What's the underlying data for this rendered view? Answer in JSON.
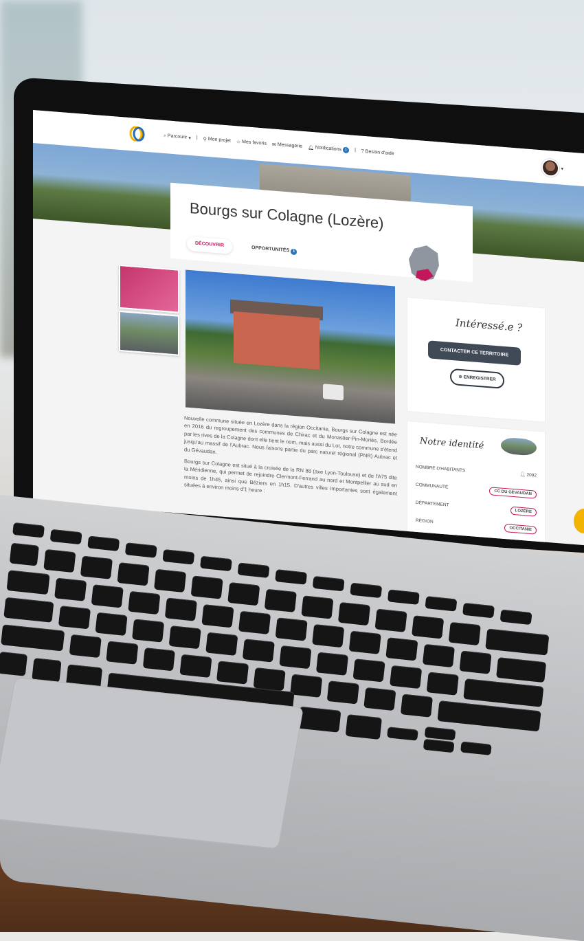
{
  "nav": {
    "items": [
      {
        "icon": "search-icon",
        "label": "Parcourir",
        "has_dropdown": true
      },
      {
        "icon": "pin-icon",
        "label": "Mon projet"
      },
      {
        "icon": "star-icon",
        "label": "Mes favoris"
      },
      {
        "icon": "mail-icon",
        "label": "Messagerie"
      },
      {
        "icon": "bell-icon",
        "label": "Notifications",
        "badge": "1"
      },
      {
        "icon": "help-icon",
        "label": "Besoin d'aide"
      }
    ]
  },
  "page": {
    "title": "Bourgs sur Colagne (Lozère)",
    "tabs": [
      {
        "label": "DÉCOUVRIR",
        "active": true
      },
      {
        "label": "OPPORTUNITÉS",
        "badge": "1",
        "active": false
      }
    ]
  },
  "description": {
    "paragraphs": [
      "Nouvelle commune située en Lozère dans la région Occitanie, Bourgs sur Colagne est née en 2016 du regroupement des communes de Chirac et du Monastier-Pin-Moriès. Bordée par les rives de la Colagne dont elle tient le nom, mais aussi du Lot, notre commune s'étend jusqu'au massif de l'Aubrac. Nous faisons partie du parc naturel régional (PNR) Aubrac et du Gévaudan.",
      "Bourgs sur Colagne est situé à la croisée de la RN 88 (axe Lyon-Toulouse) et de l'A75 dite la Méridienne, qui permet de rejoindre Clermont-Ferrand au nord et Montpellier au sud en moins de 1h45, ainsi que Béziers en 1h15. D'autres villes importantes sont également situées à environ moins d'1 heure :"
    ]
  },
  "interest_panel": {
    "heading": "Intéressé.e ?",
    "contact_button": "CONTACTER CE TERRITOIRE",
    "save_button": "ENREGISTRER"
  },
  "identity_panel": {
    "heading": "Notre identité",
    "rows": [
      {
        "label": "NOMBRE D'HABITANTS",
        "value": "2092"
      },
      {
        "label": "COMMUNAUTÉ",
        "value": "CC DU GÉVAUDAN"
      },
      {
        "label": "DÉPARTEMENT",
        "value": "LOZÈRE"
      },
      {
        "label": "RÉGION",
        "value": "OCCITANIE"
      }
    ]
  },
  "colors": {
    "accent": "#c2185b",
    "button_dark": "#3f4a56",
    "badge_blue": "#2a74b8"
  }
}
